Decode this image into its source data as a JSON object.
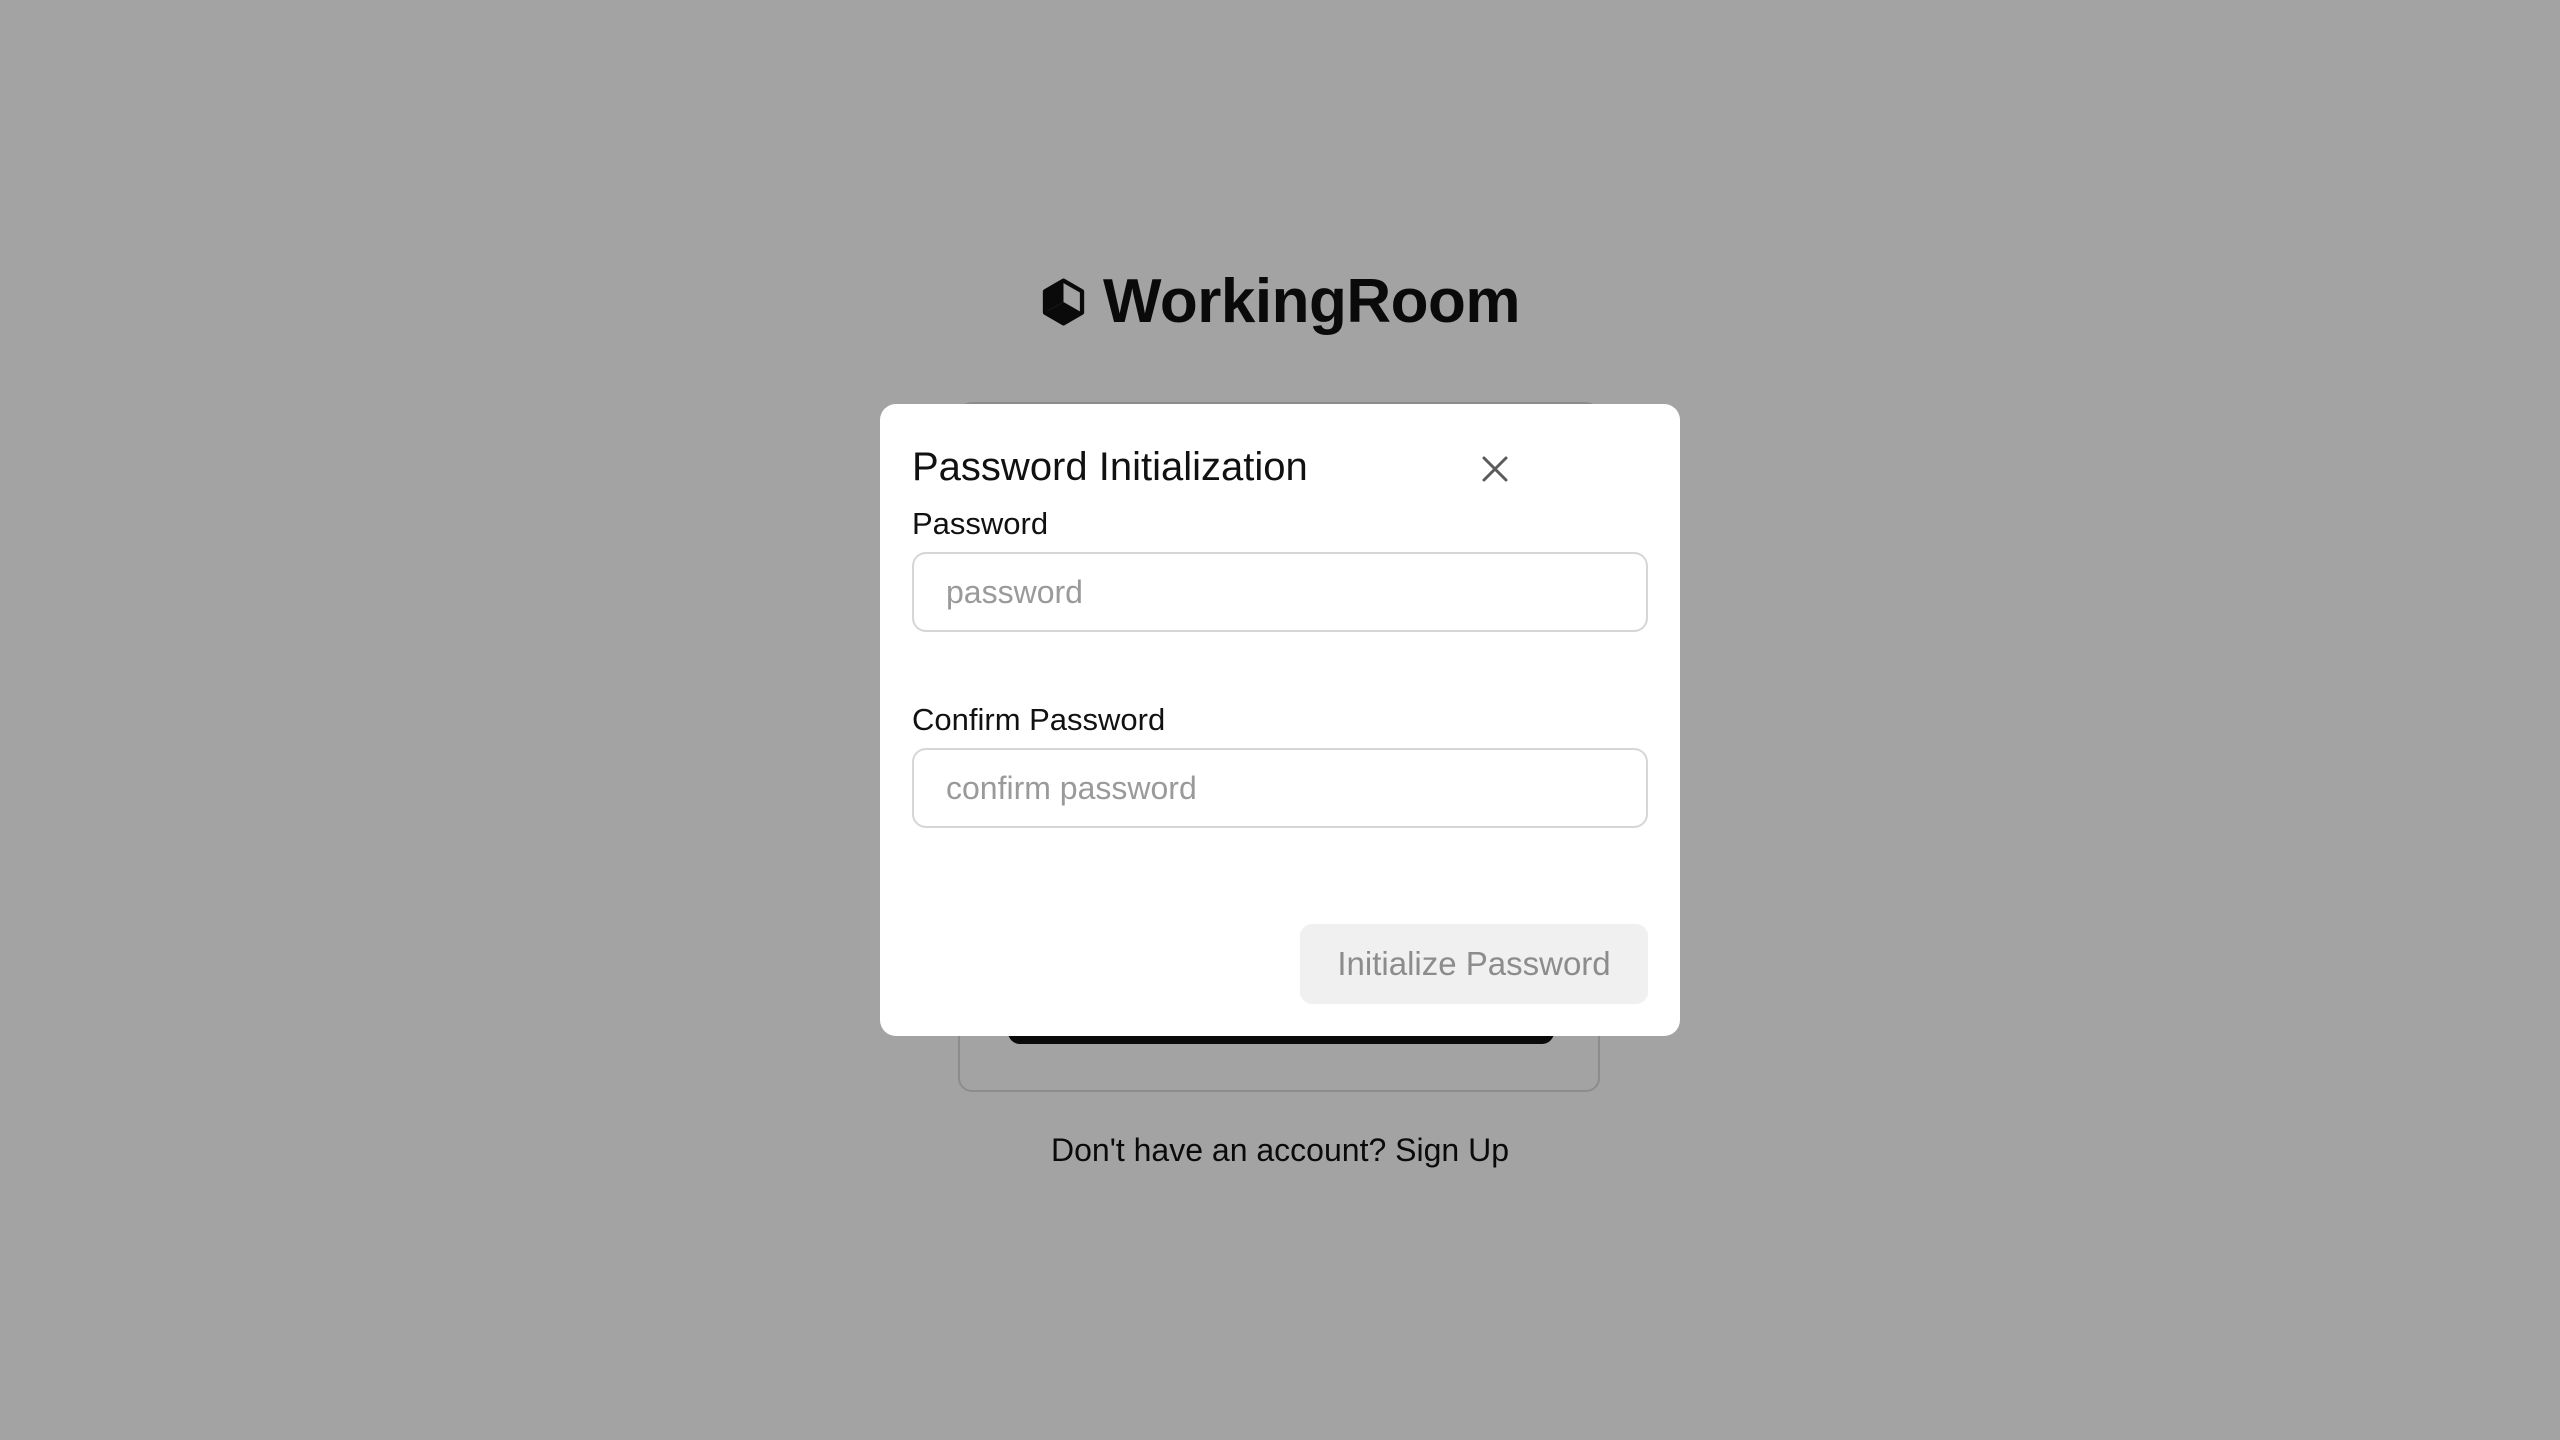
{
  "app": {
    "brand_name": "WorkingRoom",
    "logo_icon": "hexagon-cube-icon"
  },
  "login": {
    "signup_prompt": "Don't have an account?",
    "signup_link": "Sign Up"
  },
  "modal": {
    "title": "Password Initialization",
    "close_icon": "close-icon",
    "password": {
      "label": "Password",
      "value": "",
      "placeholder": "password"
    },
    "confirm_password": {
      "label": "Confirm Password",
      "value": "",
      "placeholder": "confirm password"
    },
    "submit_label": "Initialize Password",
    "submit_disabled": true
  },
  "colors": {
    "overlay": "#5c5c5c",
    "text": "#111111",
    "button_disabled_bg": "#f0f0f0",
    "button_disabled_text": "#8c8c8c",
    "placeholder": "#9a9a9a"
  }
}
